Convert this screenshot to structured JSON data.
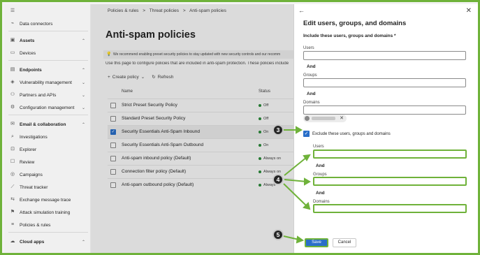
{
  "sidebar": {
    "items": [
      {
        "label": "Data connectors",
        "icon": "plug-icon",
        "bold": false
      },
      {
        "label": "Assets",
        "icon": "assets-icon",
        "bold": true,
        "chevron": "^"
      },
      {
        "label": "Devices",
        "icon": "device-icon",
        "bold": false
      },
      {
        "label": "Endpoints",
        "icon": "endpoint-icon",
        "bold": true,
        "chevron": "^"
      },
      {
        "label": "Vulnerability management",
        "icon": "shield-icon",
        "bold": false,
        "chevron": "v"
      },
      {
        "label": "Partners and APIs",
        "icon": "api-icon",
        "bold": false,
        "chevron": "v"
      },
      {
        "label": "Configuration management",
        "icon": "settings-icon",
        "bold": false,
        "chevron": "v"
      },
      {
        "label": "Email & collaboration",
        "icon": "mail-icon",
        "bold": true,
        "chevron": "^"
      },
      {
        "label": "Investigations",
        "icon": "investigation-icon",
        "bold": false
      },
      {
        "label": "Explorer",
        "icon": "explorer-icon",
        "bold": false
      },
      {
        "label": "Review",
        "icon": "review-icon",
        "bold": false
      },
      {
        "label": "Campaigns",
        "icon": "campaign-icon",
        "bold": false
      },
      {
        "label": "Threat tracker",
        "icon": "tracker-icon",
        "bold": false
      },
      {
        "label": "Exchange message trace",
        "icon": "trace-icon",
        "bold": false
      },
      {
        "label": "Attack simulation training",
        "icon": "simulation-icon",
        "bold": false
      },
      {
        "label": "Policies & rules",
        "icon": "policy-icon",
        "bold": false
      },
      {
        "label": "Cloud apps",
        "icon": "cloud-icon",
        "bold": true,
        "chevron": "^"
      }
    ]
  },
  "main": {
    "breadcrumb": [
      "Policies & rules",
      ">",
      "Threat policies",
      ">",
      "Anti-spam policies"
    ],
    "title": "Anti-spam policies",
    "banner": "We recommend enabling preset security policies to stay updated with new security controls and our recomm",
    "intro": "Use this page to configure policies that are included in anti-spam protection. These policies include",
    "toolbar": {
      "create": "Create policy",
      "refresh": "Refresh"
    },
    "columns": {
      "name": "Name",
      "status": "Status"
    },
    "rows": [
      {
        "name": "Strict Preset Security Policy",
        "status": "Off",
        "checked": false
      },
      {
        "name": "Standard Preset Security Policy",
        "status": "Off",
        "checked": false
      },
      {
        "name": "Security Essentials Anti-Spam Inbound",
        "status": "On",
        "checked": true
      },
      {
        "name": "Security Essentials Anti-Spam Outbound",
        "status": "On",
        "checked": false
      },
      {
        "name": "Anti-spam inbound policy (Default)",
        "status": "Always on",
        "checked": false
      },
      {
        "name": "Connection filter policy (Default)",
        "status": "Always on",
        "checked": false
      },
      {
        "name": "Anti-spam outbound policy (Default)",
        "status": "Always",
        "checked": false
      }
    ]
  },
  "panel": {
    "title": "Edit users, groups, and domains",
    "include_label": "Include these users, groups and domains *",
    "users": "Users",
    "and": "And",
    "groups": "Groups",
    "domains": "Domains",
    "exclude_label": "Exclude these users, groups and domains",
    "save": "Save",
    "cancel": "Cancel"
  },
  "callouts": [
    "3",
    "4",
    "5"
  ],
  "colors": {
    "accent": "#2a6fc9",
    "highlight": "#6fb23a",
    "badge": "#262626"
  }
}
